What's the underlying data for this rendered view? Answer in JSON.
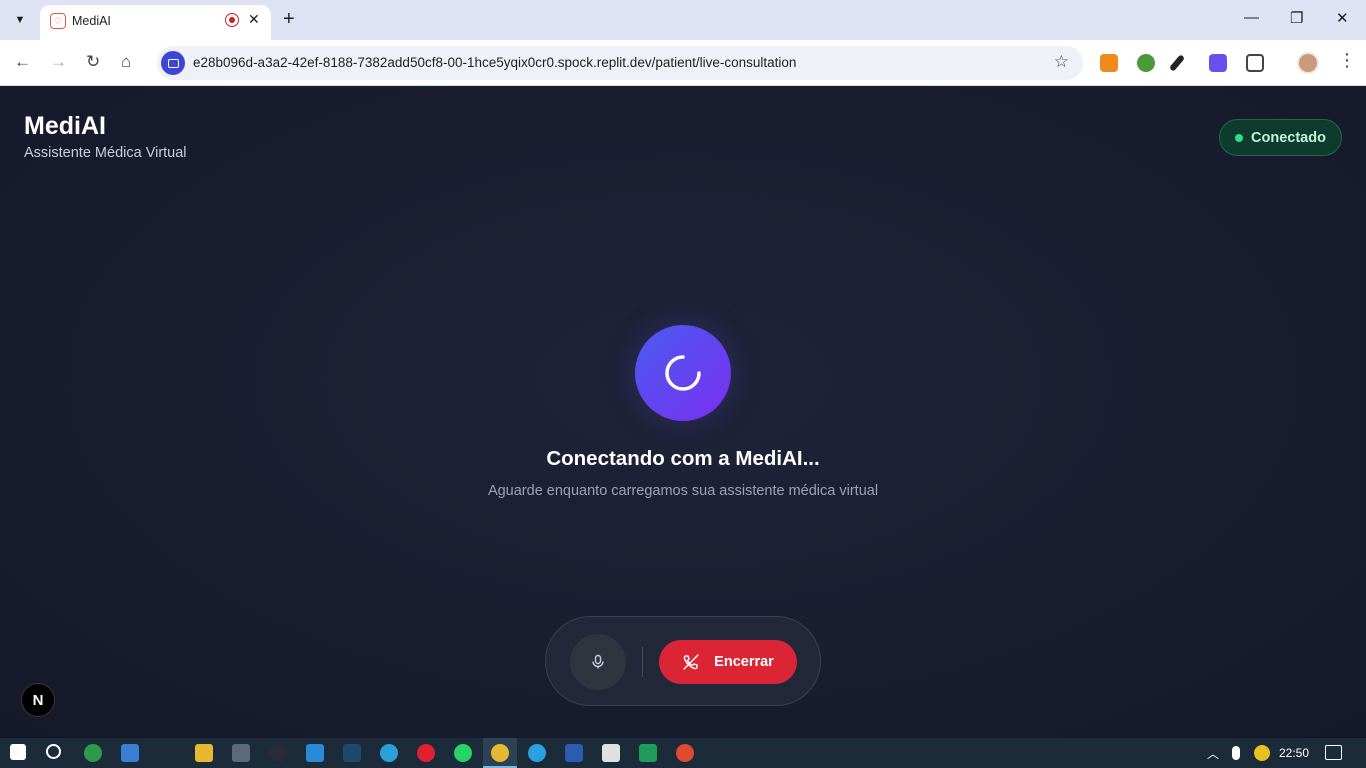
{
  "browser": {
    "tab_title": "MediAI",
    "url": "e28b096d-a3a2-42ef-8188-7382add50cf8-00-1hce5yqix0cr0.spock.replit.dev/patient/live-consultation",
    "new_tab": "+",
    "close_tab": "✕",
    "minimize": "—",
    "restore": "❐",
    "close_window": "✕"
  },
  "app": {
    "brand_title": "MediAI",
    "brand_subtitle": "Assistente Médica Virtual",
    "status_label": "Conectado",
    "status_color": "#2ee07f",
    "connect_title": "Conectando com a MediAI...",
    "connect_subtitle": "Aguarde enquanto carregamos sua assistente médica virtual",
    "end_label": "Encerrar",
    "end_color": "#dc2534",
    "n_badge": "N"
  },
  "taskbar": {
    "clock": "22:50"
  }
}
